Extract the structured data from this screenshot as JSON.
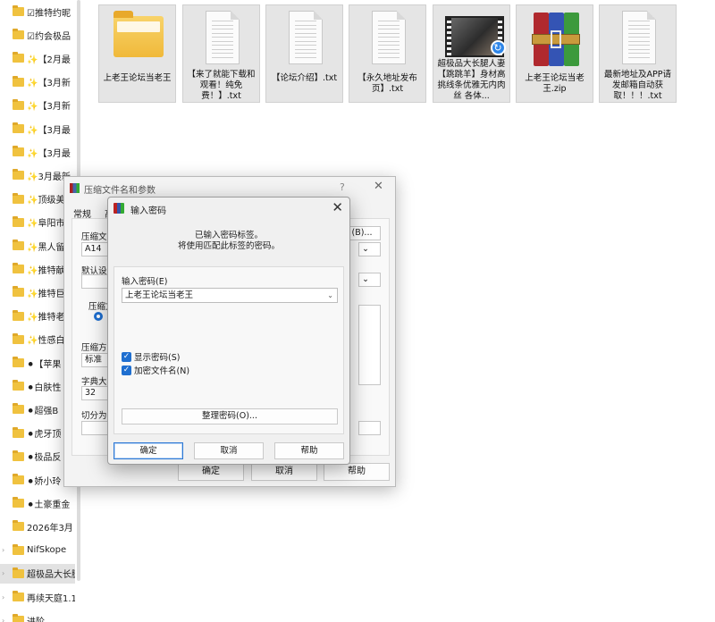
{
  "nav": {
    "items": [
      {
        "label": "☑推特约昵"
      },
      {
        "label": "☑约会极品"
      },
      {
        "label": "✨【2月最"
      },
      {
        "label": "✨【3月新"
      },
      {
        "label": "✨【3月新"
      },
      {
        "label": "✨【3月最"
      },
      {
        "label": "✨【3月最"
      },
      {
        "label": "✨3月最新"
      },
      {
        "label": "✨顶级美"
      },
      {
        "label": "✨阜阳市"
      },
      {
        "label": "✨黑人留"
      },
      {
        "label": "✨推特献"
      },
      {
        "label": "✨推特巨"
      },
      {
        "label": "✨推特老"
      },
      {
        "label": "✨性感白"
      },
      {
        "label": "⚫【苹果"
      },
      {
        "label": "⚫白肤性"
      },
      {
        "label": "⚫超强B"
      },
      {
        "label": "⚫虎牙顶"
      },
      {
        "label": "⚫极品反"
      },
      {
        "label": "⚫娇小玲"
      },
      {
        "label": "⚫土豪重金"
      },
      {
        "label": "2026年3月"
      },
      {
        "label": "NifSkope"
      },
      {
        "label": "超极品大长腿"
      },
      {
        "label": "再续天庭1.1"
      },
      {
        "label": "进阶…"
      }
    ],
    "selected_index": 24
  },
  "files": [
    {
      "name": "上老王论坛当老王",
      "icon": "folder-icon"
    },
    {
      "name": "【来了就能下载和观看！纯免费！】.txt",
      "icon": "text-file-icon"
    },
    {
      "name": "【论坛介绍】.txt",
      "icon": "text-file-icon"
    },
    {
      "name": "【永久地址发布页】.txt",
      "icon": "text-file-icon"
    },
    {
      "name": "超极品大长腿人妻【跳跳羊】身材高挑线条优雅无内肉丝 各体...",
      "icon": "video-file-icon"
    },
    {
      "name": "上老王论坛当老王.zip",
      "icon": "winrar-archive-icon"
    },
    {
      "name": "最新地址及APP请发邮箱自动获取！！！.txt",
      "icon": "text-file-icon"
    }
  ],
  "back_dialog": {
    "title": "压缩文件名和参数",
    "help_glyph": "?",
    "close_glyph": "✕",
    "tabs": [
      "常规",
      "高"
    ],
    "archive_name_label": "压缩文",
    "archive_name_value": "A14",
    "browse_label": "(B)...",
    "default_profile_label": "默认设",
    "format_label": "压缩文",
    "method_label": "压缩方",
    "method_value": "标准",
    "dict_label": "字典大小",
    "dict_value": "32",
    "split_label": "切分为",
    "ok": "确定",
    "cancel": "取消",
    "help": "帮助"
  },
  "password_dialog": {
    "title": "输入密码",
    "close_glyph": "✕",
    "info_line1": "已输入密码标签。",
    "info_line2": "将使用匹配此标签的密码。",
    "password_label": "输入密码(E)",
    "password_value": "上老王论坛当老王",
    "show_password_label": "显示密码(S)",
    "show_password_checked": true,
    "encrypt_names_label": "加密文件名(N)",
    "encrypt_names_checked": true,
    "organize_button": "整理密码(O)...",
    "ok": "确定",
    "cancel": "取消",
    "help": "帮助"
  }
}
